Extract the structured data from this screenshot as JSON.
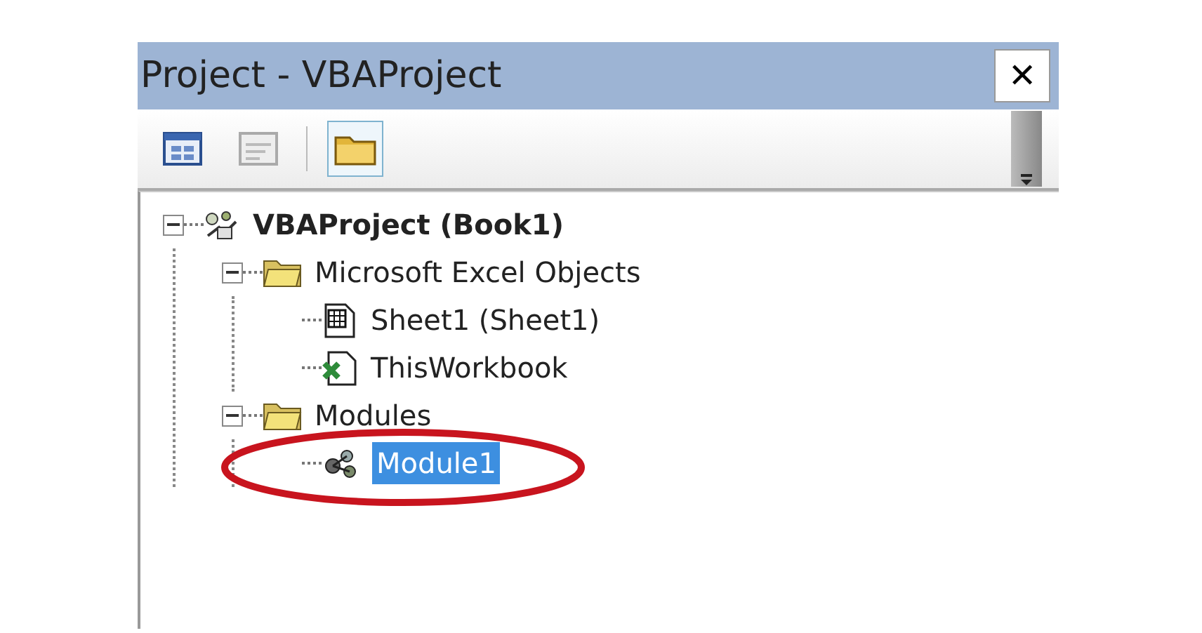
{
  "window": {
    "title": "Project - VBAProject",
    "close": "✕"
  },
  "toolbar": [
    {
      "kind": "view-object",
      "selected": false,
      "disabled": false
    },
    {
      "kind": "view-code",
      "selected": false,
      "disabled": true
    },
    {
      "kind": "toggle-folders",
      "selected": true,
      "disabled": false
    }
  ],
  "tree": [
    {
      "label": "VBAProject (Book1)",
      "kind": "project",
      "expanded": true,
      "selected": false,
      "children": [
        {
          "label": "Microsoft Excel Objects",
          "kind": "folder",
          "expanded": true,
          "selected": false,
          "children": [
            {
              "label": "Sheet1 (Sheet1)",
              "kind": "sheet",
              "selected": false
            },
            {
              "label": "ThisWorkbook",
              "kind": "workbook",
              "selected": false
            }
          ]
        },
        {
          "label": "Modules",
          "kind": "folder",
          "expanded": true,
          "selected": false,
          "children": [
            {
              "label": "Module1",
              "kind": "module",
              "selected": true,
              "circled": true
            }
          ]
        }
      ]
    }
  ]
}
